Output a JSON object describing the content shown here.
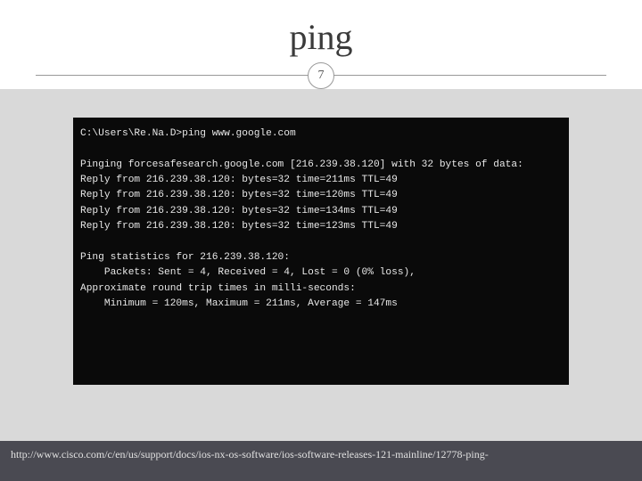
{
  "title": "ping",
  "page_number": "7",
  "terminal": {
    "prompt_line": "C:\\Users\\Re.Na.D>ping www.google.com",
    "blank": "",
    "pinging_line": "Pinging forcesafesearch.google.com [216.239.38.120] with 32 bytes of data:",
    "replies": [
      "Reply from 216.239.38.120: bytes=32 time=211ms TTL=49",
      "Reply from 216.239.38.120: bytes=32 time=120ms TTL=49",
      "Reply from 216.239.38.120: bytes=32 time=134ms TTL=49",
      "Reply from 216.239.38.120: bytes=32 time=123ms TTL=49"
    ],
    "stats_header": "Ping statistics for 216.239.38.120:",
    "packets_line": "    Packets: Sent = 4, Received = 4, Lost = 0 (0% loss),",
    "approx_line": "Approximate round trip times in milli-seconds:",
    "minmax_line": "    Minimum = 120ms, Maximum = 211ms, Average = 147ms"
  },
  "footer_url": "http://www.cisco.com/c/en/us/support/docs/ios-nx-os-software/ios-software-releases-121-mainline/12778-ping-"
}
